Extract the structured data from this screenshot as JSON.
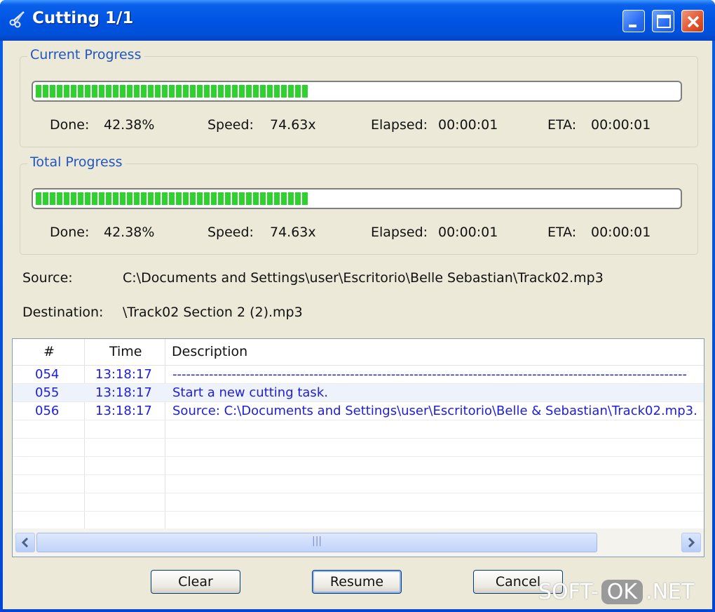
{
  "window": {
    "title": "Cutting 1/1"
  },
  "current_progress": {
    "title": "Current Progress",
    "fraction": 0.4238,
    "done_label": "Done:",
    "done_value": "42.38%",
    "speed_label": "Speed:",
    "speed_value": "74.63x",
    "elapsed_label": "Elapsed:",
    "elapsed_value": "00:00:01",
    "eta_label": "ETA:",
    "eta_value": "00:00:01"
  },
  "total_progress": {
    "title": "Total Progress",
    "fraction": 0.4238,
    "done_label": "Done:",
    "done_value": "42.38%",
    "speed_label": "Speed:",
    "speed_value": "74.63x",
    "elapsed_label": "Elapsed:",
    "elapsed_value": "00:00:01",
    "eta_label": "ETA:",
    "eta_value": "00:00:01"
  },
  "files": {
    "source_label": "Source:",
    "source_value": "C:\\Documents and Settings\\user\\Escritorio\\Belle  Sebastian\\Track02.mp3",
    "destination_label": "Destination:",
    "destination_value": "\\Track02  Section 2 (2).mp3"
  },
  "log": {
    "columns": [
      "#",
      "Time",
      "Description"
    ],
    "rows": [
      {
        "num": "054",
        "time": "13:18:17",
        "desc": "-----------------------------------------------------------------------------------------------------------------"
      },
      {
        "num": "055",
        "time": "13:18:17",
        "desc": "Start a new cutting task."
      },
      {
        "num": "056",
        "time": "13:18:17",
        "desc": "Source:  C:\\Documents and Settings\\user\\Escritorio\\Belle & Sebastian\\Track02.mp3."
      }
    ]
  },
  "buttons": {
    "clear": "Clear",
    "resume": "Resume",
    "cancel": "Cancel"
  },
  "watermark": {
    "left": "SOFT-",
    "mid": "OK",
    "right": ".NET"
  },
  "colors": {
    "titlebar": "#0054e3",
    "progress": "#2ed12e",
    "log_text": "#1d1de0"
  }
}
